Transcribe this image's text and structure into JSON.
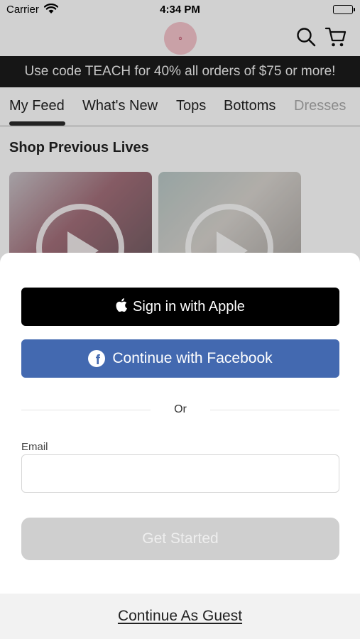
{
  "status_bar": {
    "carrier": "Carrier",
    "time": "4:34 PM"
  },
  "header": {
    "logo_icon": "store-logo-icon",
    "search_icon": "search-icon",
    "cart_icon": "cart-icon"
  },
  "promo": {
    "text": "Use code TEACH for 40% all orders of $75 or more!"
  },
  "tabs": {
    "items": [
      {
        "label": "My Feed"
      },
      {
        "label": "What's New"
      },
      {
        "label": "Tops"
      },
      {
        "label": "Bottoms"
      },
      {
        "label": "Dresses"
      }
    ],
    "active": "My Feed"
  },
  "feed": {
    "section_title": "Shop Previous Lives"
  },
  "sheet": {
    "apple_button": "Sign in with Apple",
    "facebook_button": "Continue with Facebook",
    "or_text": "Or",
    "email_label": "Email",
    "email_value": "",
    "email_placeholder": "",
    "get_started": "Get Started",
    "guest_link": "Continue As Guest"
  },
  "colors": {
    "promo_bg": "#1b1b1b",
    "apple_bg": "#000000",
    "facebook_bg": "#4369b0",
    "get_started_disabled_bg": "#cfcfcf",
    "guest_bar_bg": "#f2f2f2"
  }
}
